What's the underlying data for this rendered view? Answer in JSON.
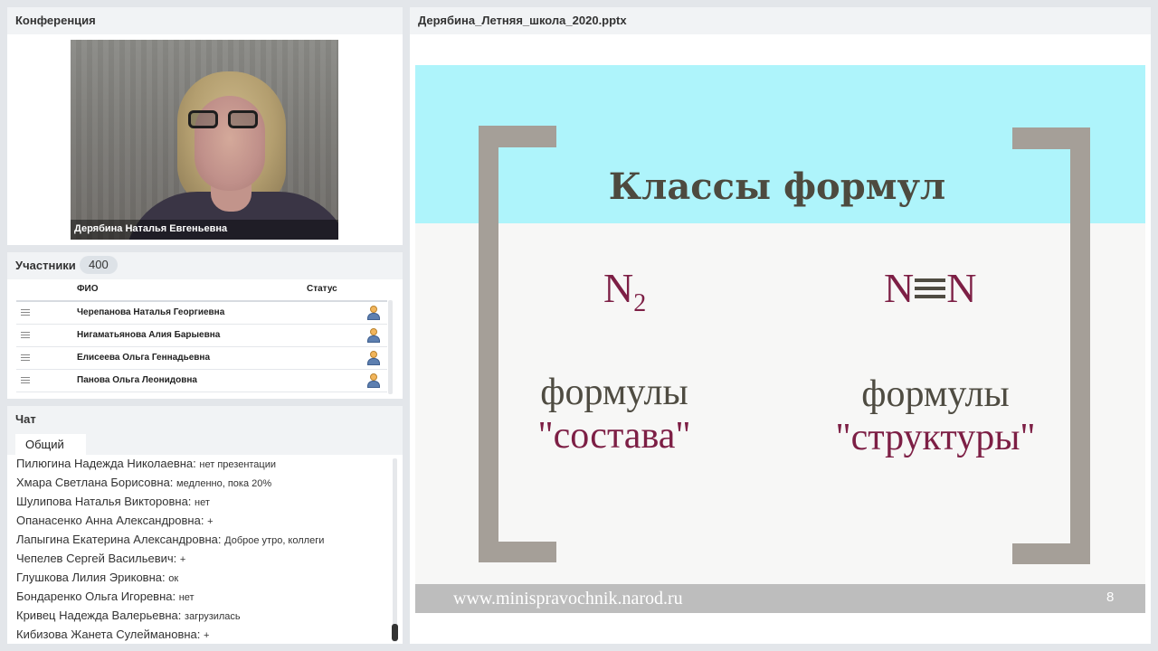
{
  "conference": {
    "title": "Конференция",
    "speaker_name": "Дерябина Наталья Евгеньевна"
  },
  "participants": {
    "title": "Участники",
    "count": "400",
    "col_name": "ФИО",
    "col_status": "Статус",
    "rows": [
      {
        "name": "Черепанова Наталья Георгиевна"
      },
      {
        "name": "Нигаматьянова Алия Барыевна"
      },
      {
        "name": "Елисеева Ольга Геннадьевна"
      },
      {
        "name": "Панова Ольга Леонидовна"
      }
    ]
  },
  "chat": {
    "title": "Чат",
    "tab": "Общий",
    "messages": [
      {
        "author": "Пилюгина Надежда Николаевна:",
        "text": "нет презентации"
      },
      {
        "author": "Хмара Светлана Борисовна:",
        "text": "медленно, пока 20%"
      },
      {
        "author": "Шулипова Наталья Викторовна:",
        "text": "нет"
      },
      {
        "author": "Опанасенко Анна Александровна:",
        "text": "+"
      },
      {
        "author": "Лапыгина Екатерина Александровна:",
        "text": "Доброе утро, коллеги"
      },
      {
        "author": "Чепелев Сергей Васильевич:",
        "text": "+"
      },
      {
        "author": "Глушкова Лилия Эриковна:",
        "text": "ок"
      },
      {
        "author": "Бондаренко Ольга Игоревна:",
        "text": "нет"
      },
      {
        "author": "Кривец Надежда Валерьевна:",
        "text": "загрузилась"
      },
      {
        "author": "Кибизова Жанета Сулеймановна:",
        "text": "+"
      }
    ]
  },
  "presentation": {
    "filename": "Дерябина_Летняя_школа_2020.pptx",
    "slide": {
      "title": "Классы формул",
      "formula_left_base": "N",
      "formula_left_sub": "2",
      "formula_right_left": "N",
      "formula_right_right": "N",
      "label_left_1": "формулы",
      "label_left_2": "\"состава\"",
      "label_right_1": "формулы",
      "label_right_2": "\"структуры\"",
      "footer_url": "www.minispravochnik.narod.ru",
      "page_number": "8"
    }
  },
  "colors": {
    "slide_band": "#aef4fb",
    "formula": "#7d1f45",
    "bracket": "#a59f98"
  }
}
